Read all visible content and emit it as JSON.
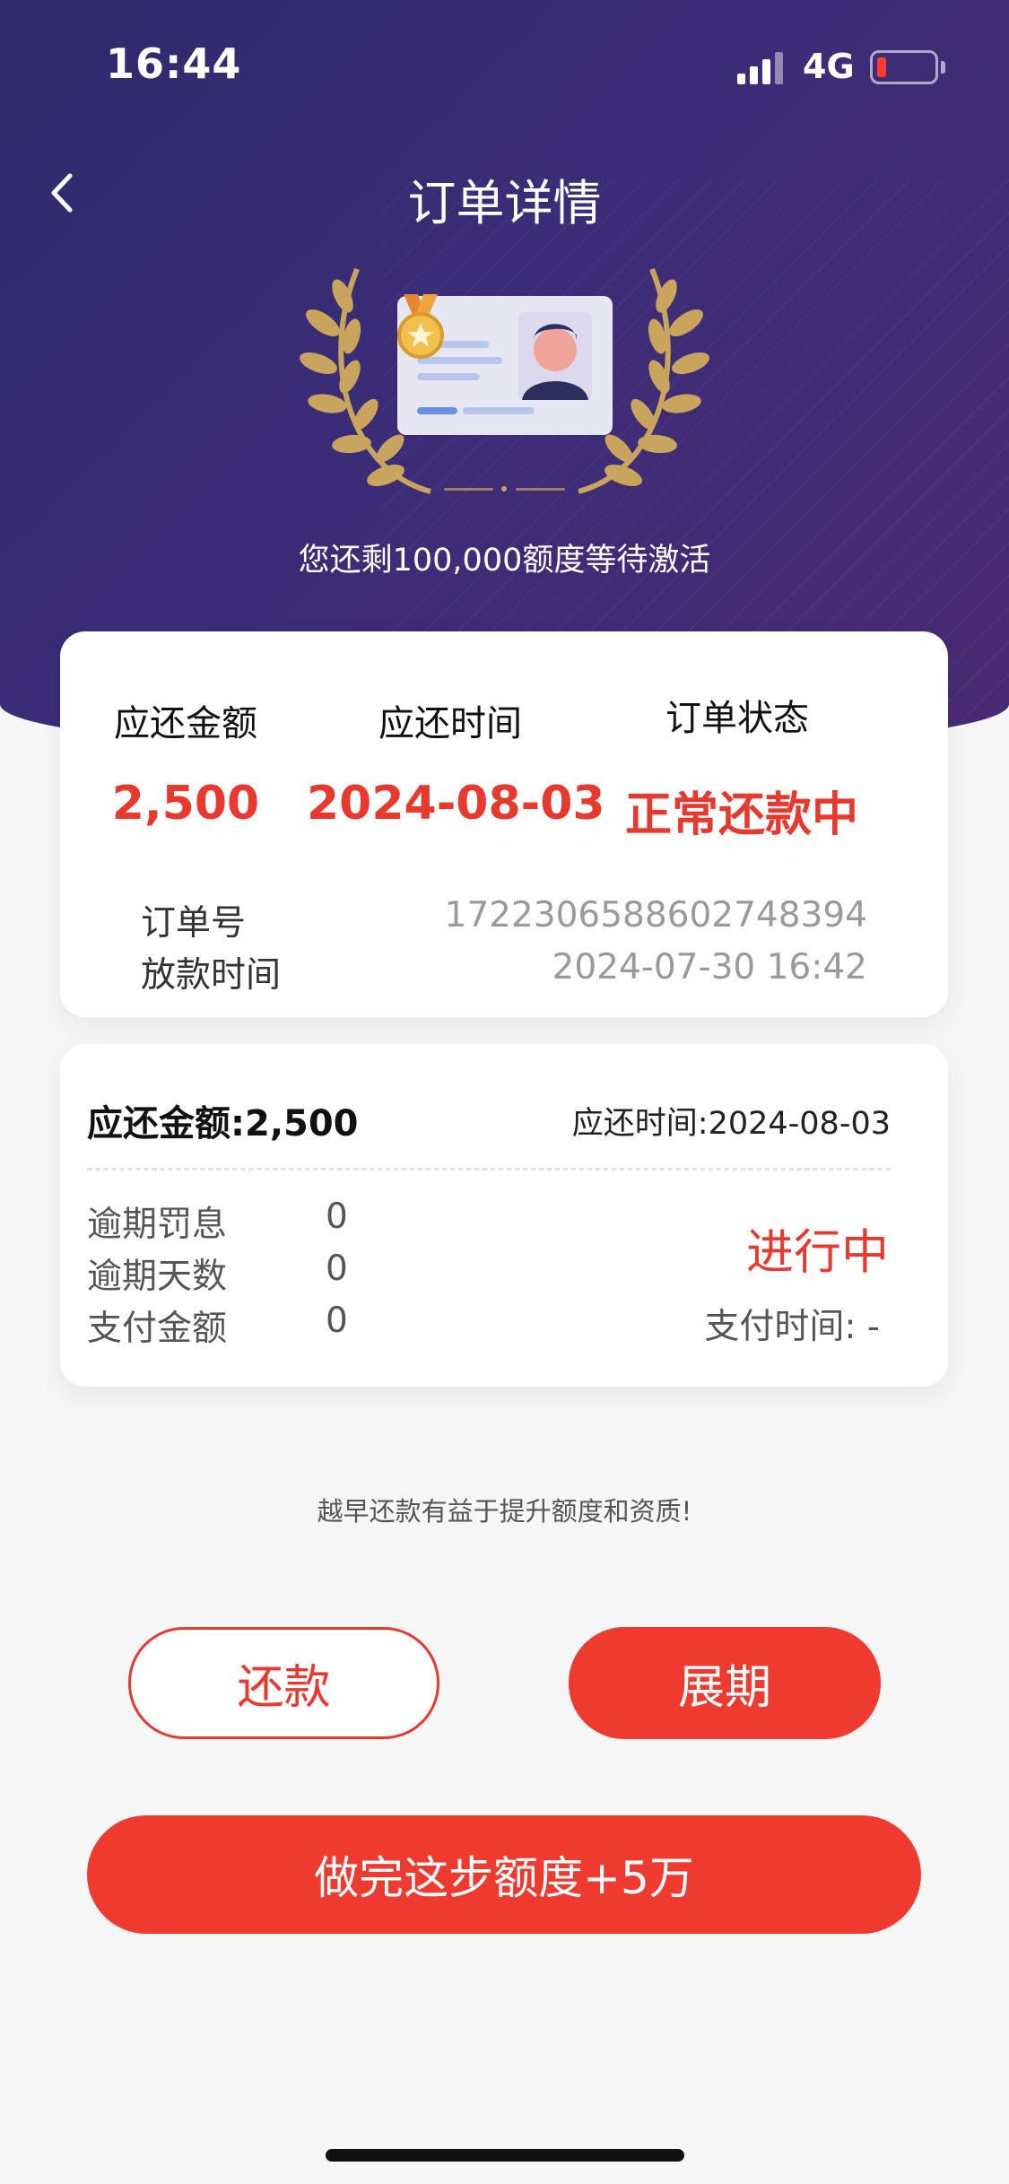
{
  "status_bar": {
    "time": "16:44",
    "network": "4G",
    "battery_color": "#ff3b30"
  },
  "nav": {
    "back_icon": "chevron-left-icon",
    "title": "订单详情"
  },
  "hero": {
    "quota_text": "您还剩100,000额度等待激活",
    "icons": [
      "laurel-wreath-icon",
      "id-card-icon",
      "medal-icon"
    ]
  },
  "order_summary": {
    "headers": [
      "应还金额",
      "应还时间",
      "订单状态"
    ],
    "values": [
      "2,500",
      "2024-08-03",
      "正常还款中"
    ],
    "order_no_label": "订单号",
    "order_no": "1722306588602748394",
    "loan_time_label": "放款时间",
    "loan_time": "2024-07-30 16:42"
  },
  "installment": {
    "amount_text": "应还金额:2,500",
    "due_time_text": "应还时间:2024-08-03",
    "rows": [
      {
        "label": "逾期罚息",
        "value": "0"
      },
      {
        "label": "逾期天数",
        "value": "0"
      },
      {
        "label": "支付金额",
        "value": "0"
      }
    ],
    "status": "进行中",
    "pay_time_text": "支付时间: -"
  },
  "tip": "越早还款有益于提升额度和资质!",
  "buttons": {
    "repay": "还款",
    "extend": "展期",
    "boost": "做完这步额度+5万"
  },
  "colors": {
    "accent": "#ef3a2f",
    "hero_start": "#2f2a6b",
    "hero_end": "#4a2a72",
    "gold": "#c9a45c"
  }
}
